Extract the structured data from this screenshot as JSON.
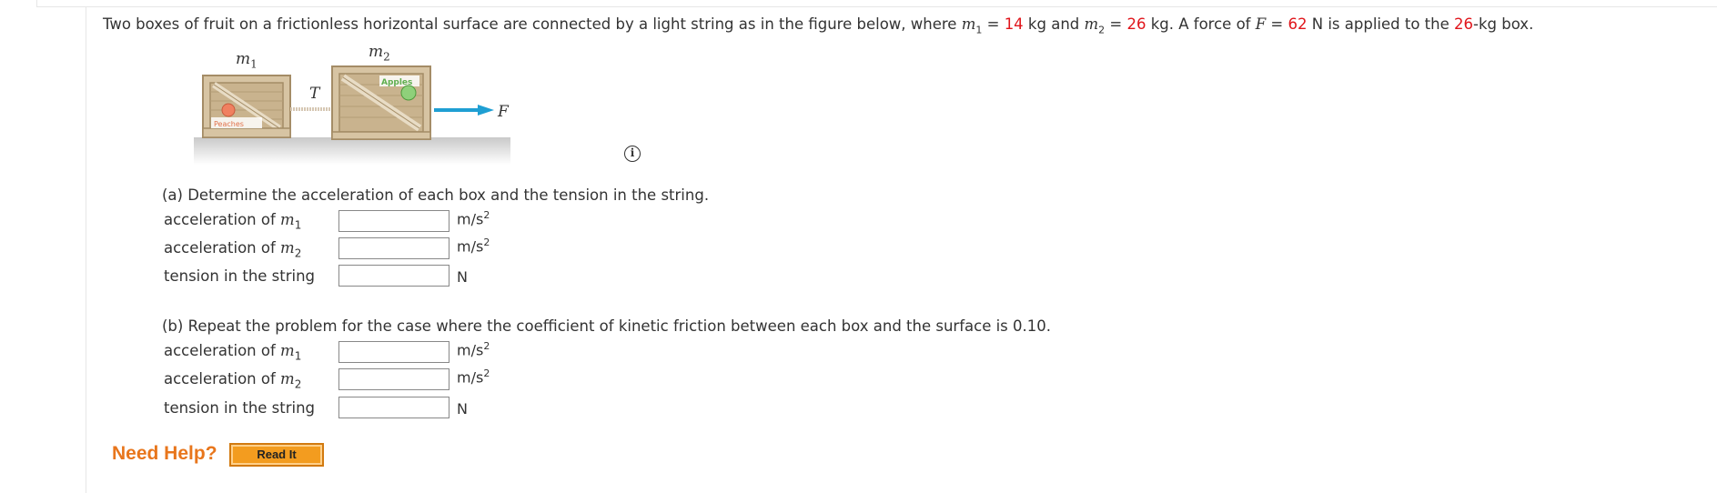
{
  "problem": {
    "s1": "Two boxes of fruit on a frictionless horizontal surface are connected by a light string as in the figure below, where ",
    "m1_sym": "m",
    "m1_sub": "1",
    "eq1": " = ",
    "m1_val": "14",
    "s2": " kg and ",
    "m2_sym": "m",
    "m2_sub": "2",
    "eq2": " = ",
    "m2_val": "26",
    "s3": " kg. A force of ",
    "F_sym": "F",
    "eq3": " = ",
    "F_val": "62",
    "s4": " N is applied to the ",
    "box_val": "26",
    "s5": "-kg box."
  },
  "figure": {
    "label_m1": "m",
    "label_m1_sub": "1",
    "label_m2": "m",
    "label_m2_sub": "2",
    "label_T": "T",
    "label_F": "F",
    "crate1_text": "Peaches",
    "crate2_text": "Apples"
  },
  "info_icon": "i",
  "part_a": {
    "title": "(a) Determine the acceleration of each box and the tension in the string.",
    "rows": [
      {
        "label": "acceleration of ",
        "sym": "m",
        "sub": "1",
        "value": "",
        "unit": "m/s",
        "unit_sup": "2"
      },
      {
        "label": "acceleration of ",
        "sym": "m",
        "sub": "2",
        "value": "",
        "unit": "m/s",
        "unit_sup": "2"
      },
      {
        "label": "tension in the string",
        "sym": "",
        "sub": "",
        "value": "",
        "unit": "N",
        "unit_sup": ""
      }
    ]
  },
  "part_b": {
    "title": "(b) Repeat the problem for the case where the coefficient of kinetic friction between each box and the surface is 0.10.",
    "rows": [
      {
        "label": "acceleration of ",
        "sym": "m",
        "sub": "1",
        "value": "",
        "unit": "m/s",
        "unit_sup": "2"
      },
      {
        "label": "acceleration of ",
        "sym": "m",
        "sub": "2",
        "value": "",
        "unit": "m/s",
        "unit_sup": "2"
      },
      {
        "label": "tension in the string",
        "sym": "",
        "sub": "",
        "value": "",
        "unit": "N",
        "unit_sup": ""
      }
    ]
  },
  "help": {
    "need_help": "Need Help?",
    "read_it": "Read It"
  },
  "colors": {
    "given_value": "#e0151b",
    "need_help": "#e8761c",
    "read_it_bg": "#f39c1f",
    "arrow": "#1f9fd3"
  }
}
